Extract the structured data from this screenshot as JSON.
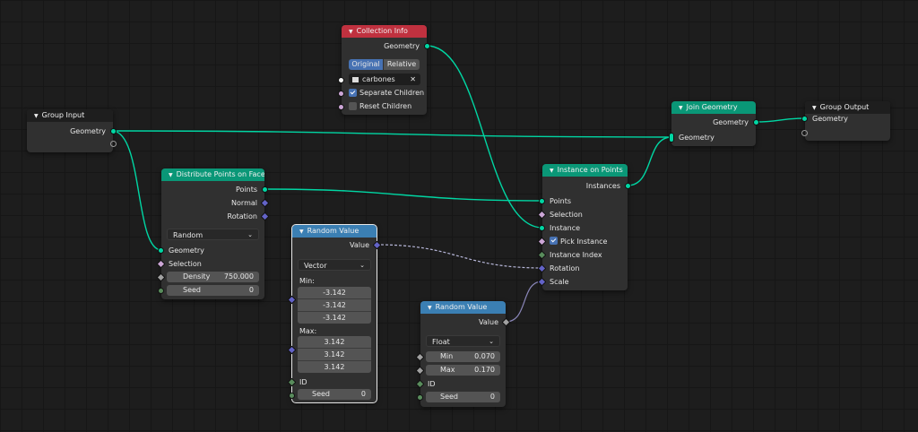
{
  "nodes": {
    "group_input": {
      "title": "Group Input",
      "out_geometry": "Geometry"
    },
    "collection_info": {
      "title": "Collection Info",
      "out_geometry": "Geometry",
      "toggle_original": "Original",
      "toggle_relative": "Relative",
      "collection_value": "carbones",
      "separate_children": "Separate Children",
      "reset_children": "Reset Children"
    },
    "join_geometry": {
      "title": "Join Geometry",
      "out_geometry": "Geometry",
      "in_geometry": "Geometry"
    },
    "group_output": {
      "title": "Group Output",
      "in_geometry": "Geometry"
    },
    "distribute_points": {
      "title": "Distribute Points on Faces",
      "out_points": "Points",
      "out_normal": "Normal",
      "out_rotation": "Rotation",
      "mode": "Random",
      "in_geometry": "Geometry",
      "in_selection": "Selection",
      "density_label": "Density",
      "density_value": "750.000",
      "seed_label": "Seed",
      "seed_value": "0"
    },
    "instance_on_points": {
      "title": "Instance on Points",
      "out_instances": "Instances",
      "in_points": "Points",
      "in_selection": "Selection",
      "in_instance": "Instance",
      "in_pick_instance": "Pick Instance",
      "in_instance_index": "Instance Index",
      "in_rotation": "Rotation",
      "in_scale": "Scale"
    },
    "random_value_vector": {
      "title": "Random Value",
      "out_value": "Value",
      "type": "Vector",
      "min_label": "Min:",
      "min_values": [
        "-3.142",
        "-3.142",
        "-3.142"
      ],
      "max_label": "Max:",
      "max_values": [
        "3.142",
        "3.142",
        "3.142"
      ],
      "id_label": "ID",
      "seed_label": "Seed",
      "seed_value": "0"
    },
    "random_value_float": {
      "title": "Random Value",
      "out_value": "Value",
      "type": "Float",
      "min_label": "Min",
      "min_value": "0.070",
      "max_label": "Max",
      "max_value": "0.170",
      "id_label": "ID",
      "seed_label": "Seed",
      "seed_value": "0"
    }
  },
  "colors": {
    "geometry_socket": "#00d6a3",
    "vector_socket": "#6363c7",
    "integer_socket": "#598c5c",
    "float_socket": "#a1a1a1",
    "geometry_header": "#0a9777",
    "utility_header": "#3b7fb3",
    "input_header": "#c0313f"
  }
}
